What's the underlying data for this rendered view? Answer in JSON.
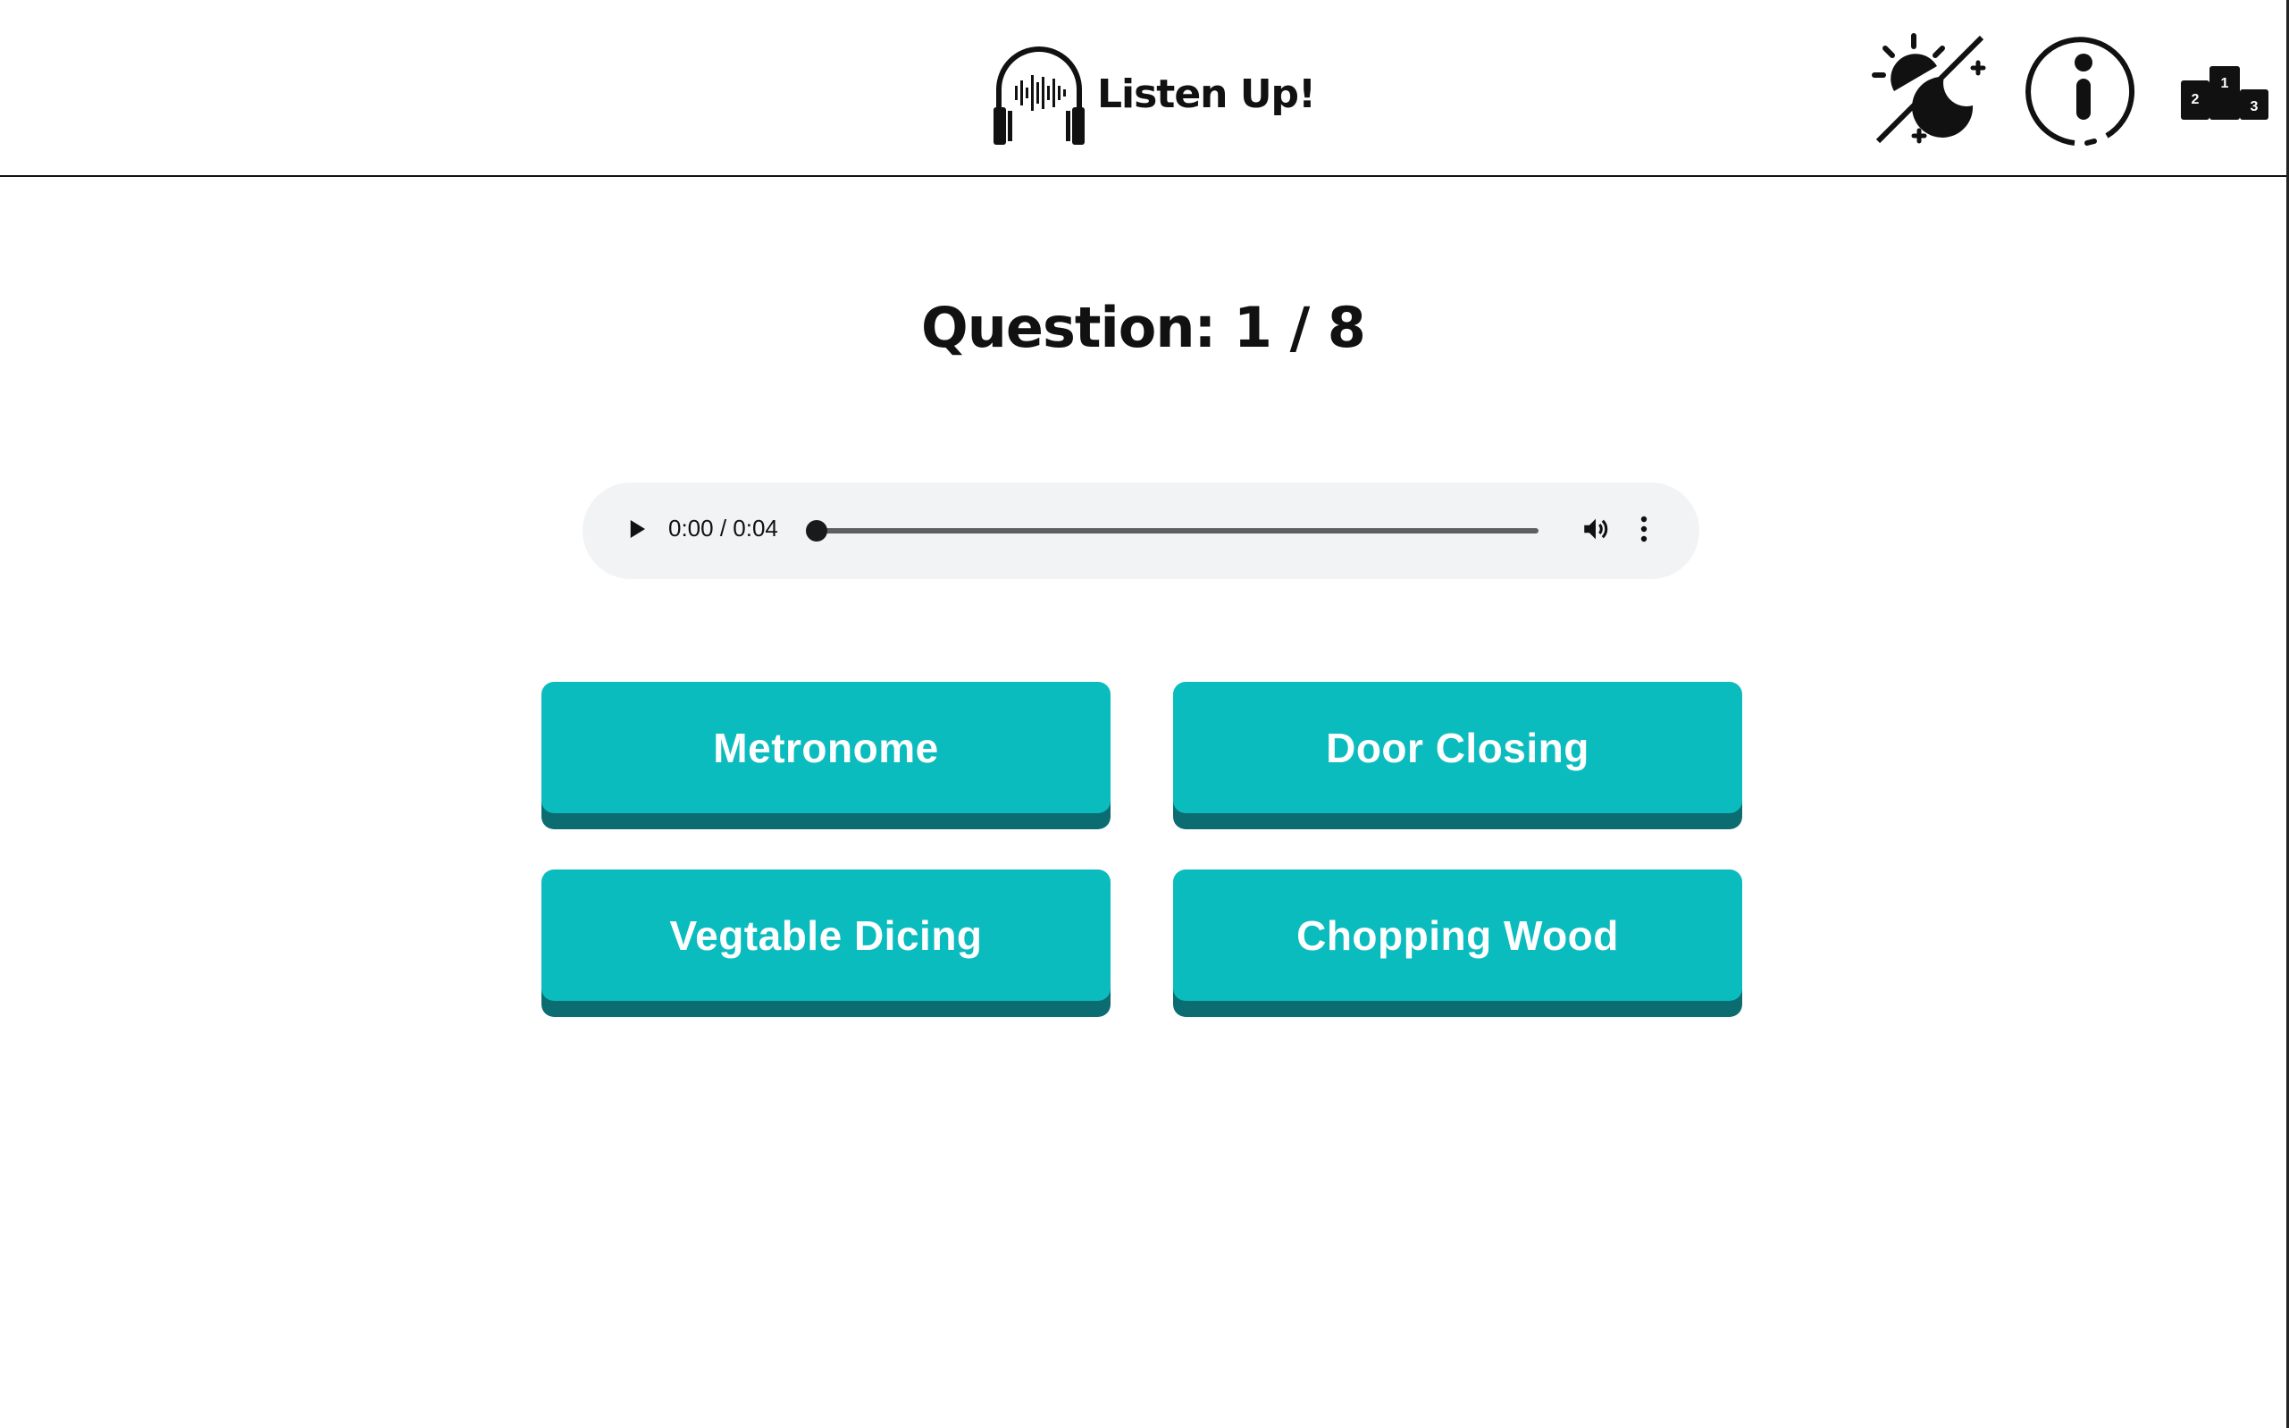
{
  "header": {
    "title": "Listen Up!",
    "logo_icon": "headphones-waveform-icon",
    "theme_toggle_icon": "sun-moon-icon",
    "info_icon": "info-icon",
    "leaderboard_icon": "podium-icon",
    "podium_labels": [
      "1",
      "2",
      "3"
    ]
  },
  "quiz": {
    "question_label": "Question: 1 / 8"
  },
  "audio_player": {
    "time_display": "0:00 / 0:04",
    "progress": 0,
    "play_icon": "play-icon",
    "volume_icon": "volume-icon",
    "more_icon": "more-vertical-icon"
  },
  "answers": [
    {
      "label": "Metronome"
    },
    {
      "label": "Door Closing"
    },
    {
      "label": "Vegtable Dicing"
    },
    {
      "label": "Chopping Wood"
    }
  ],
  "colors": {
    "answer_bg": "#0bbcbf",
    "answer_shadow": "#0b6d71",
    "player_bg": "#f1f3f4"
  }
}
